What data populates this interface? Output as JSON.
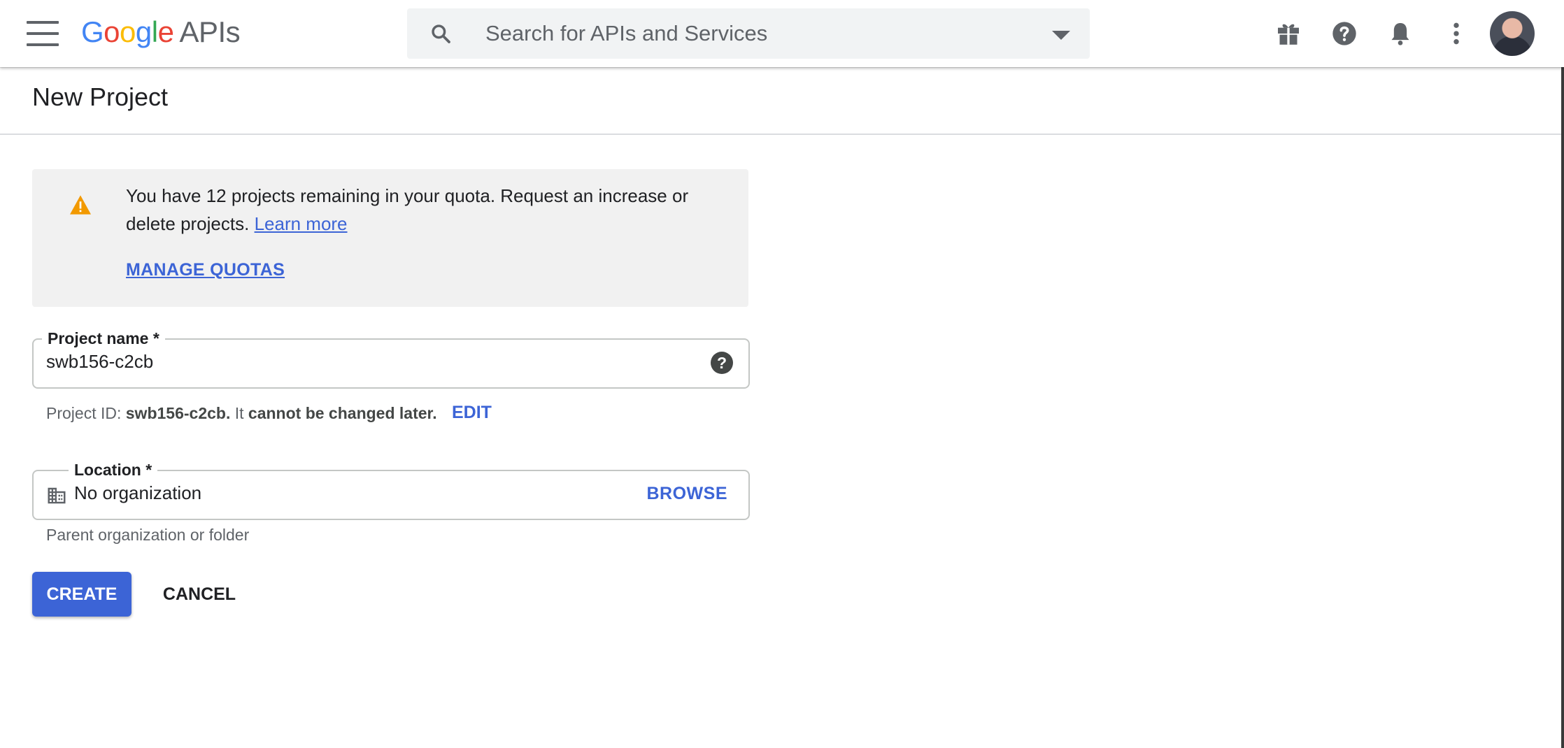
{
  "header": {
    "logo_google": [
      "G",
      "o",
      "o",
      "g",
      "l",
      "e"
    ],
    "logo_colors": [
      "#4285F4",
      "#EA4335",
      "#FBBC05",
      "#4285F4",
      "#34A853",
      "#EA4335"
    ],
    "logo_apis": "APIs",
    "search_placeholder": "Search for APIs and Services",
    "icons": [
      "menu-icon",
      "search-icon",
      "dropdown-caret-icon",
      "gift-icon",
      "help-icon",
      "notifications-bell-icon",
      "more-vert-icon",
      "account-avatar"
    ]
  },
  "page": {
    "title": "New Project"
  },
  "quota_notice": {
    "message": "You have 12 projects remaining in your quota. Request an increase or delete projects.",
    "link_text": "Learn more",
    "manage_quotas": "MANAGE QUOTAS",
    "warning_color": "#F29900"
  },
  "project_name": {
    "label": "Project name *",
    "value": "swb156-c2cb",
    "help_icon": "?"
  },
  "project_id": {
    "prefix": "Project ID: ",
    "id": "swb156-c2cb.",
    "middle": " It ",
    "note": "cannot be changed later.",
    "edit_label": "EDIT"
  },
  "location": {
    "label": "Location *",
    "value": "No organization",
    "browse_label": "BROWSE",
    "hint": "Parent organization or folder"
  },
  "actions": {
    "create_label": "CREATE",
    "cancel_label": "CANCEL"
  },
  "colors": {
    "accent": "#3C64D6",
    "notice_bg": "#F1F1F1"
  }
}
